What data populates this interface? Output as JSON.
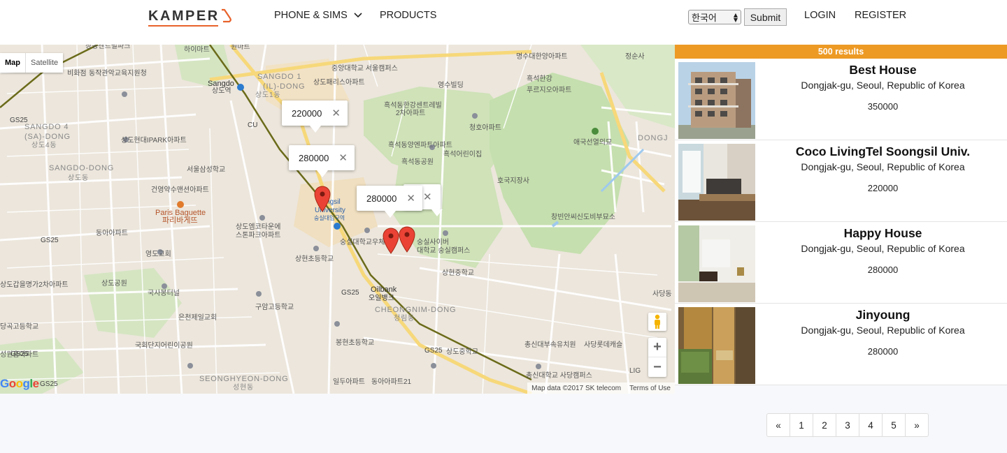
{
  "header": {
    "logo_text": "KAMPER",
    "nav": {
      "phone_sims": "PHONE & SIMS",
      "products": "PRODUCTS",
      "login": "LOGIN",
      "register": "REGISTER"
    },
    "language": {
      "selected": "한국어"
    },
    "submit_label": "Submit",
    "colors": {
      "accent": "#e8622b"
    }
  },
  "map": {
    "type_controls": {
      "map": "Map",
      "satellite": "Satellite",
      "active": "Map"
    },
    "popups": [
      {
        "price": "220000"
      },
      {
        "price": "280000"
      },
      {
        "price": "280000"
      }
    ],
    "close_glyph": "✕",
    "zoom_in": "+",
    "zoom_out": "−",
    "attribution": "Map data ©2017 SK telecom",
    "terms": "Terms of Use",
    "labels": {
      "sangdo1": "SANGDO 1\n(IL)-DONG",
      "sangdo4": "SANGDO 4\n(SA)-DONG",
      "sangdo": "SANGDO-DONG",
      "cheongnim": "CHEONGNIM-DONG",
      "seonghyeon": "SEONGHYEON-DONG",
      "sangdo_station": "Sangdo",
      "soongsil": "Soongsil\nUniversity",
      "paris": "Paris Baguette",
      "paris_kr": "파리바게뜨",
      "oilbank": "Oilbank",
      "oilbank_kr": "오일뱅크",
      "gs25": "GS25",
      "cu": "CU",
      "dongj": "DONGJ",
      "kr_labels": [
        "창동센트럴파크",
        "하이마트",
        "동작관악교육지원청",
        "상도현대IPARK아파트",
        "서울삼성학교",
        "건영약수맨션아파트",
        "동아아파트",
        "영도교회",
        "상도갑을명가2차아파트",
        "상도공원",
        "국사봉터널",
        "은천제일교회",
        "국회단지어린이공원",
        "성원홈아파트",
        "상도파크자이",
        "상도엠코타운에스톤파크아파트",
        "상현초등학교",
        "구암고등학교",
        "봉현초등학교",
        "일두아파트",
        "동아아파트21",
        "중앙대학교 서울캠퍼스",
        "영수빌딩",
        "흑석동한강센트레빌2차아파트",
        "청호아파트",
        "흑석동양엔파트아파트",
        "흑석어린이집",
        "흑석동공원",
        "명수대현대아파트",
        "정순사",
        "동아레지던스",
        "명수대한양아파트",
        "흑석한강푸르지오아파트",
        "애국선열의묘",
        "호국지장사",
        "창빈안씨신도비부묘소",
        "숭실사이버대학교 숭실캠퍼스",
        "상현중학교",
        "숭실대학교우체국",
        "사당동",
        "총신대부속유치원",
        "사당롯데캐슬",
        "총신대학교 사당캠퍼스",
        "상도중학교",
        "상도렉스빌",
        "당곡고등학교",
        "GS25",
        "상도파크자이아파트"
      ]
    }
  },
  "results": {
    "count_label": "500 results",
    "bar_color": "#ed9a25",
    "listings": [
      {
        "title": "Best House",
        "address": "Dongjak-gu, Seoul, Republic of Korea",
        "price": "350000"
      },
      {
        "title": "Coco LivingTel Soongsil Univ.",
        "address": "Dongjak-gu, Seoul, Republic of Korea",
        "price": "220000"
      },
      {
        "title": "Happy House",
        "address": "Dongjak-gu, Seoul, Republic of Korea",
        "price": "280000"
      },
      {
        "title": "Jinyoung",
        "address": "Dongjak-gu, Seoul, Republic of Korea",
        "price": "280000"
      }
    ]
  },
  "pagination": {
    "prev": "«",
    "pages": [
      "1",
      "2",
      "3",
      "4",
      "5"
    ],
    "next": "»"
  }
}
